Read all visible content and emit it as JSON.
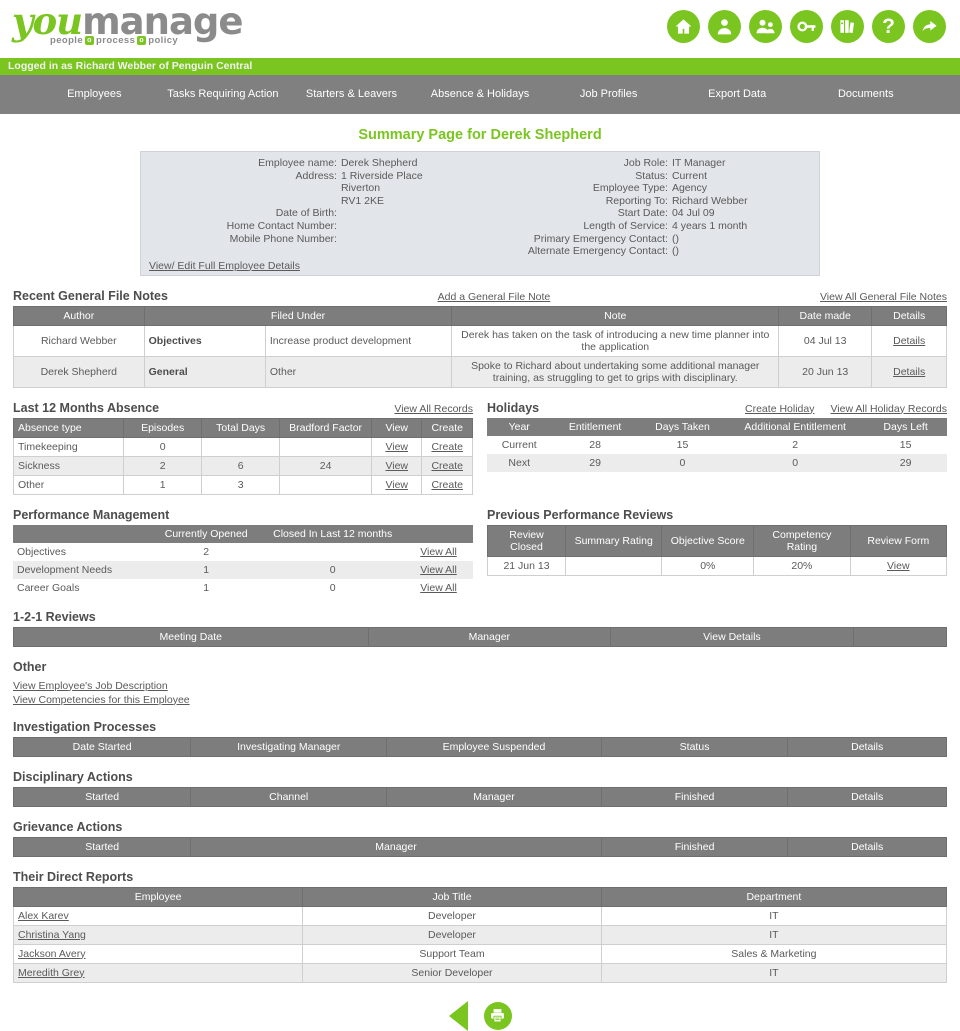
{
  "brand": {
    "logo_you": "you",
    "logo_manage": "manage",
    "tag_1": "people",
    "tag_2": "process",
    "tag_3": "policy"
  },
  "header": {
    "icons": [
      {
        "name": "home-icon",
        "label": "Home"
      },
      {
        "name": "user-icon",
        "label": "My Profile"
      },
      {
        "name": "users-icon",
        "label": "Employees"
      },
      {
        "name": "key-icon",
        "label": "Permissions"
      },
      {
        "name": "reports-icon",
        "label": "Reports"
      },
      {
        "name": "help-icon",
        "label": "Help"
      },
      {
        "name": "share-icon",
        "label": "Share"
      }
    ],
    "logged_in_text": "Logged in as Richard Webber of Penguin Central"
  },
  "nav": {
    "items": [
      {
        "label": "Employees"
      },
      {
        "label": "Tasks Requiring Action"
      },
      {
        "label": "Starters & Leavers"
      },
      {
        "label": "Absence & Holidays"
      },
      {
        "label": "Job Profiles"
      },
      {
        "label": "Export Data"
      },
      {
        "label": "Documents"
      }
    ]
  },
  "page": {
    "title": "Summary Page for Derek Shepherd"
  },
  "summary": {
    "left": [
      {
        "label": "Employee name:",
        "value": "Derek Shepherd"
      },
      {
        "label": "Address:",
        "value": "1 Riverside Place"
      },
      {
        "label": "",
        "value": "Riverton"
      },
      {
        "label": "",
        "value": "RV1 2KE"
      },
      {
        "label": "",
        "value": ""
      },
      {
        "label": "Date of Birth:",
        "value": ""
      },
      {
        "label": "Home Contact Number:",
        "value": ""
      },
      {
        "label": "Mobile Phone Number:",
        "value": ""
      }
    ],
    "right": [
      {
        "label": "Job Role:",
        "value": "IT Manager"
      },
      {
        "label": "Status:",
        "value": "Current"
      },
      {
        "label": "Employee Type:",
        "value": "Agency"
      },
      {
        "label": "Reporting To:",
        "value": "Richard Webber"
      },
      {
        "label": "Start Date:",
        "value": "04 Jul 09"
      },
      {
        "label": "Length of Service:",
        "value": "4 years 1 month"
      },
      {
        "label": "Primary Emergency Contact:",
        "value": "()"
      },
      {
        "label": "Alternate Emergency Contact:",
        "value": "()"
      }
    ],
    "edit_link": "View/ Edit Full Employee Details"
  },
  "file_notes": {
    "title": "Recent General File Notes",
    "add_link": "Add a General File Note",
    "view_all_link": "View All General File Notes",
    "columns": [
      "Author",
      "Filed Under",
      "",
      "Note",
      "Date made",
      "Details"
    ],
    "rows": [
      {
        "author": "Richard Webber",
        "category": "Objectives",
        "subcategory": "Increase product development",
        "note": "Derek has taken on the task of introducing a new time planner into the application",
        "date": "04 Jul 13",
        "details": "Details"
      },
      {
        "author": "Derek Shepherd",
        "category": "General",
        "subcategory": "Other",
        "note": "Spoke to Richard about undertaking some additional manager training, as struggling to get to grips with disciplinary.",
        "date": "20 Jun 13",
        "details": "Details"
      }
    ]
  },
  "absence": {
    "title": "Last 12 Months Absence",
    "view_all_link": "View All Records",
    "columns": [
      "Absence type",
      "Episodes",
      "Total Days",
      "Bradford Factor",
      "View",
      "Create"
    ],
    "rows": [
      {
        "type": "Timekeeping",
        "episodes": "0",
        "total_days": "",
        "bradford": "",
        "view": "View",
        "create": "Create"
      },
      {
        "type": "Sickness",
        "episodes": "2",
        "total_days": "6",
        "bradford": "24",
        "view": "View",
        "create": "Create"
      },
      {
        "type": "Other",
        "episodes": "1",
        "total_days": "3",
        "bradford": "",
        "view": "View",
        "create": "Create"
      }
    ]
  },
  "holidays": {
    "title": "Holidays",
    "create_link": "Create Holiday",
    "view_all_link": "View All Holiday Records",
    "columns": [
      "Year",
      "Entitlement",
      "Days Taken",
      "Additional Entitlement",
      "Days Left"
    ],
    "rows": [
      {
        "year": "Current",
        "entitlement": "28",
        "taken": "15",
        "additional": "2",
        "left": "15"
      },
      {
        "year": "Next",
        "entitlement": "29",
        "taken": "0",
        "additional": "0",
        "left": "29"
      }
    ]
  },
  "performance": {
    "title": "Performance Management",
    "columns": [
      "",
      "Currently Opened",
      "Closed In Last 12 months",
      ""
    ],
    "rows": [
      {
        "name": "Objectives",
        "open": "2",
        "closed": "",
        "link": "View All"
      },
      {
        "name": "Development Needs",
        "open": "1",
        "closed": "0",
        "link": "View All"
      },
      {
        "name": "Career Goals",
        "open": "1",
        "closed": "0",
        "link": "View All"
      }
    ]
  },
  "reviews": {
    "title": "Previous Performance Reviews",
    "columns": [
      "Review Closed",
      "Summary Rating",
      "Objective Score",
      "Competency Rating",
      "Review Form"
    ],
    "rows": [
      {
        "closed": "21 Jun 13",
        "summary": "",
        "objective": "0%",
        "competency": "20%",
        "form": "View"
      }
    ]
  },
  "one_to_one": {
    "title": "1-2-1 Reviews",
    "columns": [
      "Meeting Date",
      "Manager",
      "View Details",
      ""
    ],
    "rows": []
  },
  "other": {
    "title": "Other",
    "links": [
      "View Employee's Job Description ",
      "View Competencies for this Employee "
    ]
  },
  "investigation": {
    "title": "Investigation Processes",
    "columns": [
      "Date Started",
      "Investigating Manager",
      "Employee Suspended",
      "Status",
      "Details"
    ],
    "rows": []
  },
  "disciplinary": {
    "title": "Disciplinary Actions",
    "columns": [
      "Started",
      "Channel",
      "Manager",
      "Finished",
      "Details"
    ],
    "rows": []
  },
  "grievance": {
    "title": "Grievance Actions",
    "columns": [
      "Started",
      "Manager",
      "Finished",
      "Details"
    ],
    "rows": []
  },
  "direct_reports": {
    "title": "Their Direct Reports",
    "columns": [
      "Employee",
      "Job Title",
      "Department"
    ],
    "rows": [
      {
        "employee": "Alex Karev",
        "job_title": "Developer",
        "department": "IT"
      },
      {
        "employee": "Christina Yang",
        "job_title": "Developer",
        "department": "IT"
      },
      {
        "employee": "Jackson Avery",
        "job_title": "Support Team",
        "department": "Sales & Marketing"
      },
      {
        "employee": "Meredith Grey",
        "job_title": "Senior Developer",
        "department": "IT"
      }
    ]
  },
  "footer": {
    "back_icon": "back-arrow-icon",
    "print_icon": "print-icon"
  },
  "colors": {
    "brand_green": "#7ac520",
    "nav_gray": "#808080",
    "header_gray": "#7d7d7d",
    "alt_row": "#ececec",
    "summary_bg": "#e2e5ea"
  }
}
